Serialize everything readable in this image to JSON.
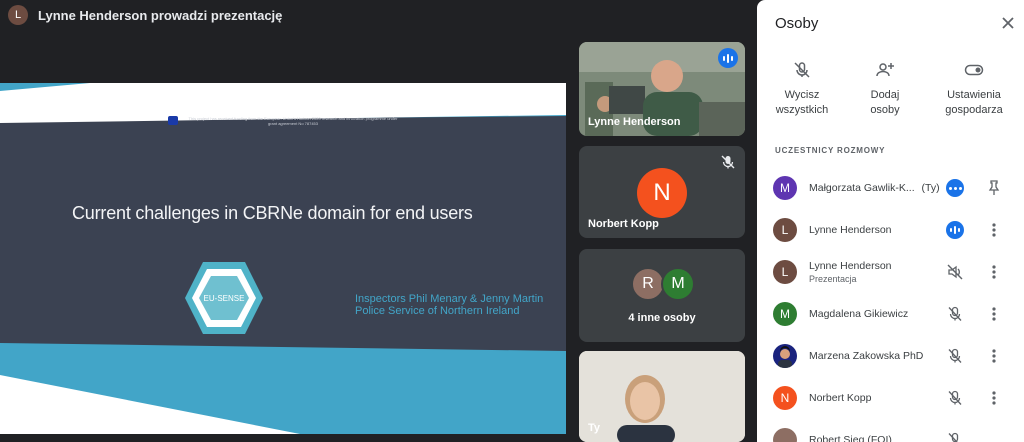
{
  "meeting": {
    "presenter_initial": "L",
    "presenting_title": "Lynne Henderson prowadzi prezentację"
  },
  "slide": {
    "funding_note": "This project has received funding from the European Union's Horizon 2020 research and innovation programme under grant agreement No 787453",
    "title": "Current challenges in CBRNe domain for end users",
    "logo_text": "EU-SENSE",
    "inspectors": "Inspectors Phil Menary & Jenny Martin",
    "police": "Police Service of Northern Ireland"
  },
  "tiles": [
    {
      "name": "Lynne Henderson",
      "state": "speaking"
    },
    {
      "name": "Norbert Kopp",
      "initial": "N",
      "state": "muted"
    },
    {
      "label": "4 inne osoby",
      "initials": [
        "R",
        "M"
      ]
    },
    {
      "name": "Ty"
    }
  ],
  "panel": {
    "title": "Osoby",
    "actions": [
      {
        "line1": "Wycisz",
        "line2": "wszystkich",
        "icon": "mic-off-icon"
      },
      {
        "line1": "Dodaj",
        "line2": "osoby",
        "icon": "person-add-icon"
      },
      {
        "line1": "Ustawienia",
        "line2": "gospodarza",
        "icon": "toggle-icon"
      }
    ],
    "section_label": "UCZESTNICY ROZMOWY",
    "participants": [
      {
        "initial": "M",
        "name": "Małgorzata Gawlik-K...",
        "tag": "(Ty)",
        "color": "#5e35b1",
        "status": "more-icon",
        "extra": "pin-icon"
      },
      {
        "initial": "L",
        "name": "Lynne Henderson",
        "color": "#6d4c41",
        "status": "speaking-icon",
        "extra": "more-vert-icon"
      },
      {
        "initial": "L",
        "name": "Lynne Henderson",
        "sub": "Prezentacja",
        "color": "#6d4c41",
        "status": "sound-off-icon",
        "extra": "more-vert-icon"
      },
      {
        "initial": "M",
        "name": "Magdalena Gikiewicz",
        "color": "#2e7d32",
        "status": "mic-off-icon",
        "extra": "more-vert-icon"
      },
      {
        "initial": "",
        "name": "Marzena Zakowska PhD",
        "color": "#1a237e",
        "status": "mic-off-icon",
        "extra": "more-vert-icon"
      },
      {
        "initial": "N",
        "name": "Norbert Kopp",
        "color": "#f4511e",
        "status": "mic-off-icon",
        "extra": "more-vert-icon"
      },
      {
        "initial": "",
        "name": "Robert Sieg (FOI)",
        "color": "#8d6e63",
        "status": "mic-off-icon",
        "extra": "more-vert-icon"
      }
    ]
  },
  "colors": {
    "accent": "#1a73e8",
    "slide_teal": "#42a5c8",
    "slide_bg": "#3b4252"
  }
}
